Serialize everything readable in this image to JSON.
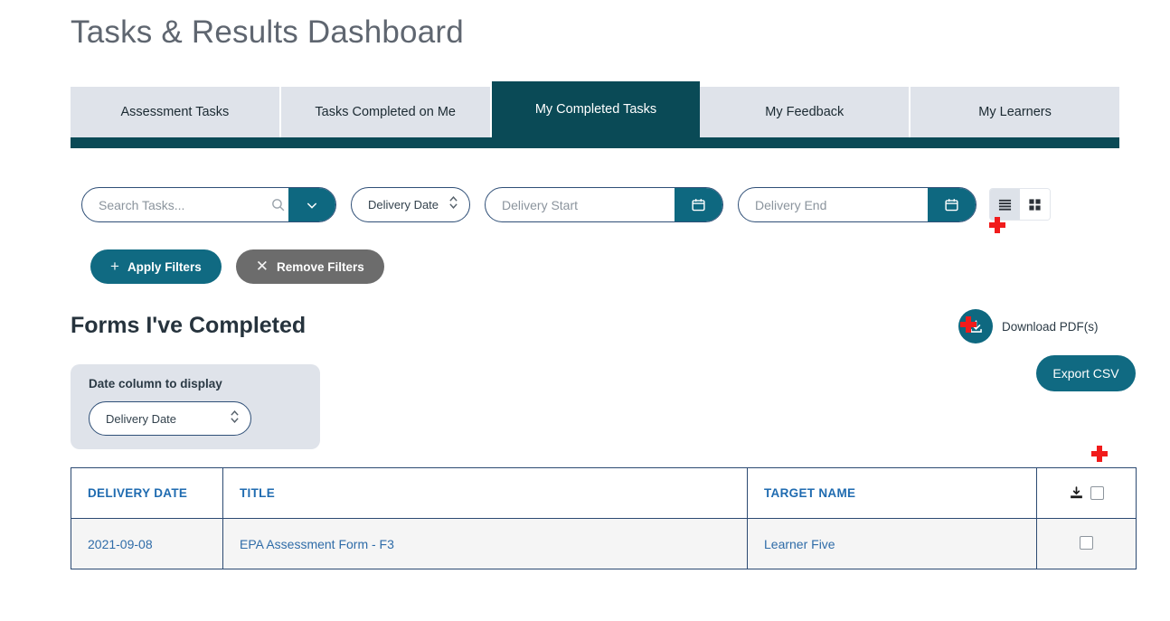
{
  "page": {
    "title": "Tasks & Results Dashboard"
  },
  "tabs": [
    {
      "label": "Assessment Tasks",
      "active": false
    },
    {
      "label": "Tasks Completed on Me",
      "active": false
    },
    {
      "label": "My Completed Tasks",
      "active": true
    },
    {
      "label": "My Feedback",
      "active": false
    },
    {
      "label": "My Learners",
      "active": false
    }
  ],
  "filters": {
    "search": {
      "placeholder": "Search Tasks...",
      "value": "",
      "icon": "search-icon",
      "dropdown_icon": "chevron-down-icon"
    },
    "sort_select": {
      "value": "Delivery Date",
      "icon": "stepper-updown-icon"
    },
    "delivery_start": {
      "placeholder": "Delivery Start",
      "value": "",
      "icon": "calendar-icon"
    },
    "delivery_end": {
      "placeholder": "Delivery End",
      "value": "",
      "icon": "calendar-icon"
    },
    "view_toggle": {
      "list_icon": "list-view-icon",
      "grid_icon": "grid-view-icon",
      "active": "list"
    },
    "apply_button": {
      "label": "Apply Filters",
      "icon": "plus-icon"
    },
    "remove_button": {
      "label": "Remove Filters",
      "icon": "close-x-icon"
    }
  },
  "section": {
    "heading": "Forms I've Completed",
    "download_pdf": {
      "label": "Download PDF(s)",
      "icon": "download-circle-icon"
    },
    "export_csv": {
      "label": "Export CSV"
    },
    "date_column_panel": {
      "label": "Date column to display",
      "select_value": "Delivery Date",
      "select_icon": "stepper-updown-icon"
    }
  },
  "table": {
    "columns": [
      "DELIVERY DATE",
      "TITLE",
      "TARGET NAME",
      ""
    ],
    "header_download_icon": "download-icon",
    "rows": [
      {
        "delivery_date": "2021-09-08",
        "title": "EPA Assessment Form - F3",
        "target_name": "Learner Five"
      }
    ]
  },
  "colors": {
    "teal_dark": "#0a4a56",
    "teal": "#0e6880",
    "tab_bg": "#dfe3ea",
    "link_blue": "#2f6ca8",
    "header_blue": "#1f6bb0",
    "gray_button": "#6c6c6c",
    "marker_red": "#f11b1b"
  },
  "markers": [
    {
      "name": "cursor-marker-view-toggle"
    },
    {
      "name": "cursor-marker-download-pdf"
    },
    {
      "name": "cursor-marker-table"
    }
  ]
}
